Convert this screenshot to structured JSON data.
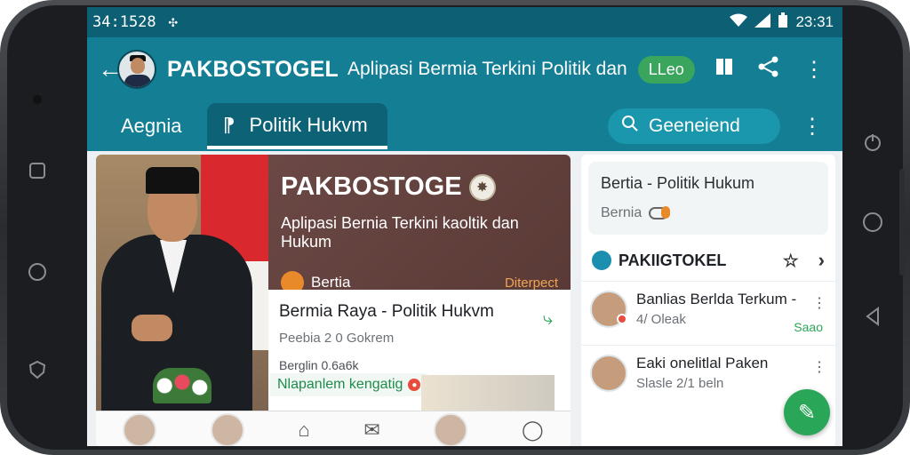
{
  "statusbar": {
    "time_left": "34:1528",
    "time_right": "23:31"
  },
  "appbar": {
    "title": "PAKBOSTOGEL",
    "subtitle": "Aplipasi Bermia Terkini Politik dan",
    "pill": "LLeo"
  },
  "tabs": {
    "first": "Aegnia",
    "active": "Politik Hukvm",
    "search_placeholder": "Geeneiend"
  },
  "hero": {
    "title": "PAKBOSTOGE",
    "subtitle": "Aplipasi Bernia Terkini kaoltik dan Hukum",
    "badge_label": "Bertia",
    "right_label": "Diterpect"
  },
  "article": {
    "title": "Bermia Raya - Politik Hukvm",
    "meta": "Peebia 2 0 Gokrem",
    "sub": "Berglin 0.6a6k",
    "tag": "Nlapanlem kengatig"
  },
  "right_panel": {
    "card_title": "Bertia - Politik Hukum",
    "card_sub": "Bernia",
    "header": "PAKIIGTOKEL",
    "items": [
      {
        "title": "Banlias Berlda Terkum -",
        "meta": "4/ Oleak",
        "badge": "Saao"
      },
      {
        "title": "Eaki onelitlal Paken",
        "meta": "Slasle 2/1 beln",
        "badge": ""
      }
    ]
  },
  "colors": {
    "accent": "#137e94",
    "status": "#0d5f74",
    "success": "#2aa658"
  },
  "icons": {
    "back": "arrow-left-icon",
    "bookmark": "bookmark-icon",
    "share": "share-icon",
    "more": "more-vert-icon",
    "search": "search-icon",
    "home": "home-icon",
    "mail": "mail-icon"
  }
}
